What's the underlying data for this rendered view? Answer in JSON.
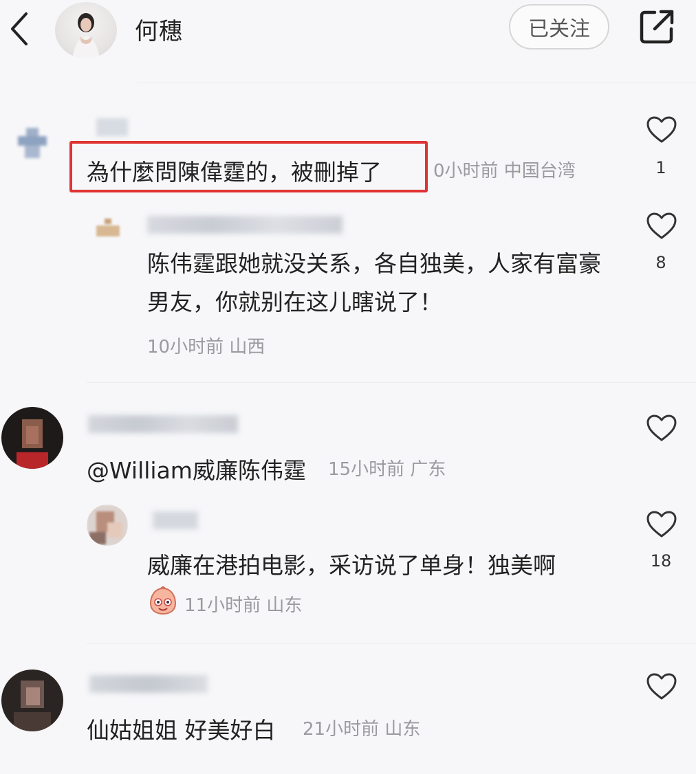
{
  "header": {
    "username": "何穗",
    "follow_label": "已关注"
  },
  "comments": [
    {
      "text": "為什麼問陳偉霆的，被刪掉了",
      "meta": "0小时前 中国台湾",
      "likes": "1",
      "highlighted": true,
      "reply": {
        "text": "陈伟霆跟她就没关系，各自独美，人家有富豪男友，你就别在这儿瞎说了！",
        "meta": "10小时前 山西",
        "likes": "8"
      }
    },
    {
      "text": "@William威廉陈伟霆",
      "meta": "15小时前 广东",
      "likes": "",
      "reply": {
        "text": "威廉在港拍电影，采访说了单身！独美啊",
        "meta": "11小时前 山东",
        "likes": "18"
      }
    },
    {
      "text": "仙姑姐姐 好美好白",
      "meta": "21小时前 山东",
      "likes": ""
    }
  ],
  "colors": {
    "highlight": "#e03333",
    "meta": "#9a9aa0",
    "background": "#f7f7f9"
  },
  "icons": [
    "back-icon",
    "share-icon",
    "heart-icon",
    "emoji-icon"
  ]
}
